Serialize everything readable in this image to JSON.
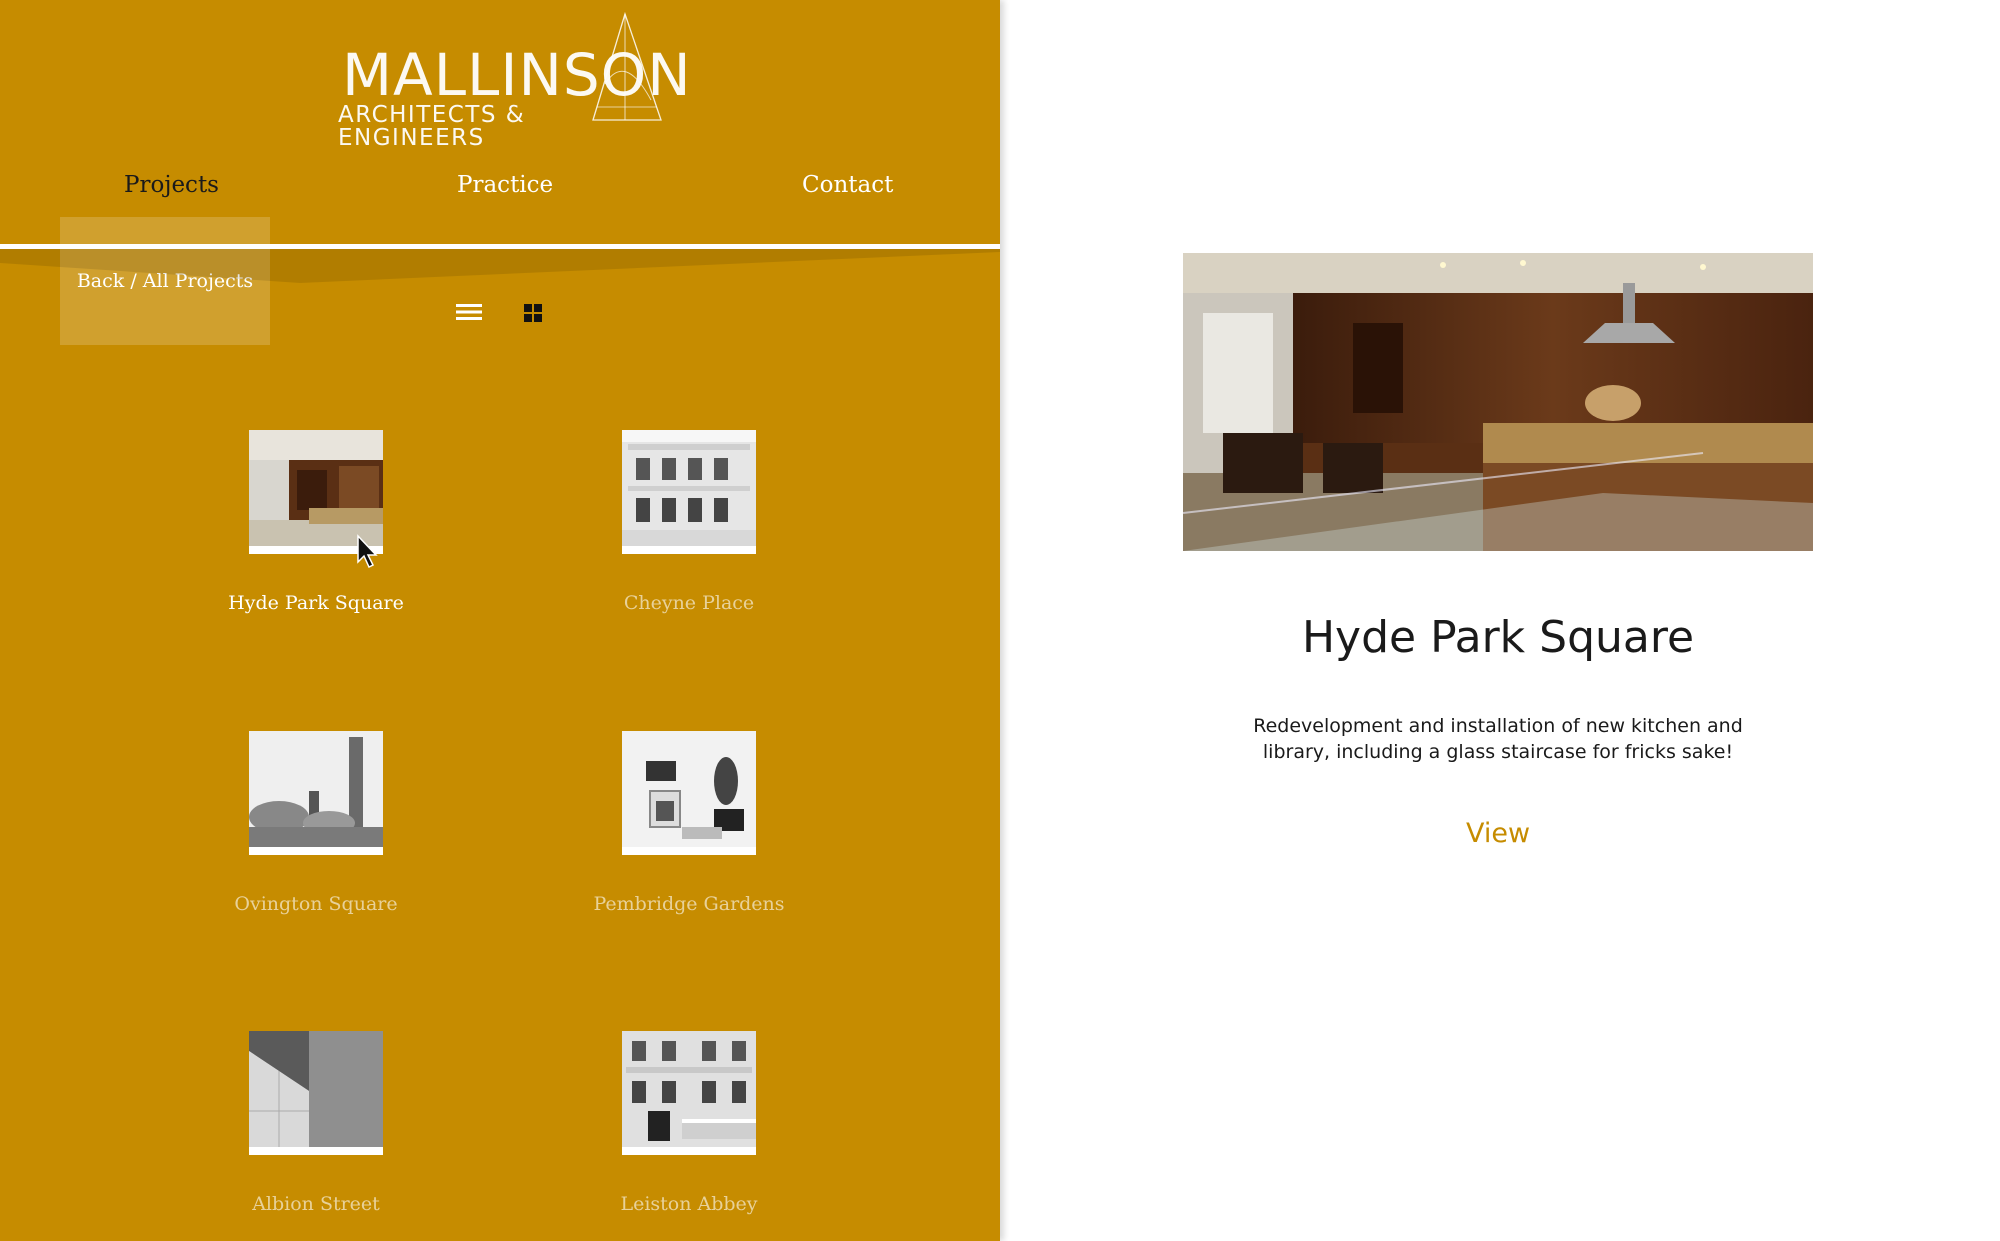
{
  "brand": {
    "name": "MALLINSON",
    "subtitle": "ARCHITECTS & ENGINEERS"
  },
  "nav": {
    "items": [
      {
        "label": "Projects",
        "active": true
      },
      {
        "label": "Practice",
        "active": false
      },
      {
        "label": "Contact",
        "active": false
      }
    ]
  },
  "toolbar": {
    "back_label": "Back / All Projects",
    "list_view_icon": "list-icon",
    "grid_view_icon": "grid-icon"
  },
  "projects": [
    {
      "title": "Hyde Park Square",
      "active": true,
      "thumb": "kitchen-interior-color"
    },
    {
      "title": "Cheyne Place",
      "active": false,
      "thumb": "white-facade-bw"
    },
    {
      "title": "Ovington Square",
      "active": false,
      "thumb": "chimney-ruins-bw"
    },
    {
      "title": "Pembridge Gardens",
      "active": false,
      "thumb": "living-room-bw"
    },
    {
      "title": "Albion Street",
      "active": false,
      "thumb": "abstract-architecture-bw"
    },
    {
      "title": "Leiston Abbey",
      "active": false,
      "thumb": "terrace-facade-bw"
    }
  ],
  "detail": {
    "title": "Hyde Park Square",
    "description": "Redevelopment and installation of new kitchen and library, including a glass staircase for fricks sake!",
    "view_label": "View"
  },
  "colors": {
    "accent": "#c68c00",
    "panel": "#c68c00",
    "text_dark": "#1a1a1a",
    "background": "#ffffff"
  }
}
